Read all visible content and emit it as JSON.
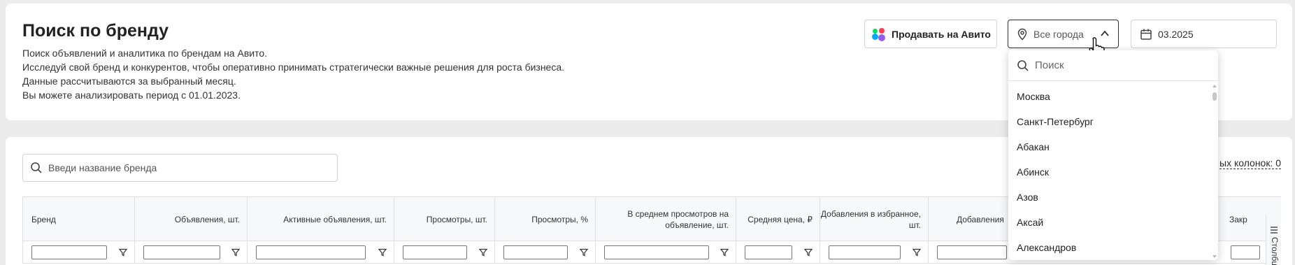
{
  "header": {
    "title": "Поиск по бренду",
    "description": [
      "Поиск объявлений и аналитика по брендам на Авито.",
      "Исследуй свой бренд и конкурентов, чтобы оперативно принимать стратегически важные решения для роста бизнеса.",
      "Данные рассчитываются за выбранный месяц.",
      "Вы можете анализировать период с 01.01.2023."
    ],
    "sell_button": "Продавать на Авито",
    "city_select": {
      "value": "Все города"
    },
    "date_select": {
      "value": "03.2025"
    }
  },
  "brand_search": {
    "placeholder": "Введи название бренда"
  },
  "hidden_columns": "ых колонок: 0",
  "table": {
    "columns": [
      "Бренд",
      "Объявления, шт.",
      "Активные объявления, шт.",
      "Просмотры, шт.",
      "Просмотры, %",
      "В среднем просмотров на объявление, шт.",
      "Средняя цена, ₽",
      "Добавления в избранное, шт.",
      "Добавления",
      "Закр"
    ],
    "side_tab": "Столбцы"
  },
  "city_dropdown": {
    "search_placeholder": "Поиск",
    "options": [
      "Москва",
      "Санкт-Петербург",
      "Абакан",
      "Абинск",
      "Азов",
      "Аксай",
      "Александров"
    ]
  },
  "colors": {
    "avito_green": "#00aaff",
    "border": "#cfd4da"
  }
}
